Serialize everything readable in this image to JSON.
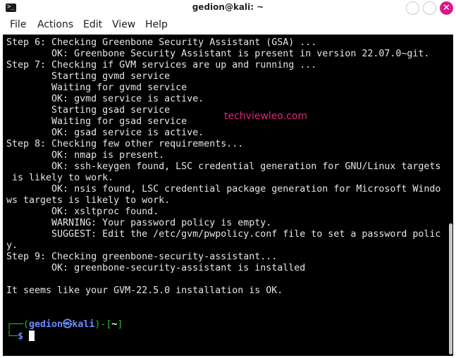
{
  "window": {
    "title": "gedion@kali: ~",
    "terminal_icon": "terminal-icon",
    "close_glyph": "✕",
    "accent_close": "#d6198b"
  },
  "menu": [
    "File",
    "Actions",
    "Edit",
    "View",
    "Help"
  ],
  "terminal": {
    "lines": [
      "Step 6: Checking Greenbone Security Assistant (GSA) ...",
      "        OK: Greenbone Security Assistant is present in version 22.07.0~git.",
      "Step 7: Checking if GVM services are up and running ...",
      "        Starting gvmd service",
      "        Waiting for gvmd service",
      "        OK: gvmd service is active.",
      "        Starting gsad service",
      "        Waiting for gsad service",
      "        OK: gsad service is active.",
      "Step 8: Checking few other requirements...",
      "        OK: nmap is present.",
      "        OK: ssh-keygen found, LSC credential generation for GNU/Linux targets",
      " is likely to work.",
      "        OK: nsis found, LSC credential package generation for Microsoft Windo",
      "ws targets is likely to work.",
      "        OK: xsltproc found.",
      "        WARNING: Your password policy is empty.",
      "        SUGGEST: Edit the /etc/gvm/pwpolicy.conf file to set a password polic",
      "y.",
      "Step 9: Checking greenbone-security-assistant...",
      "        OK: greenbone-security-assistant is installed",
      "",
      "It seems like your GVM-22.5.0 installation is OK.",
      "",
      ""
    ],
    "prompt": {
      "open": "┌──(",
      "user": "gedion㉿kali",
      "middle": ")-[",
      "dir": "~",
      "close": "]",
      "line2": "└─",
      "dollar": "$ "
    },
    "watermark": "techviewleo.com",
    "colors": {
      "prompt_frame": "#1ec61e",
      "prompt_user": "#6e8bff",
      "watermark": "#e0257a"
    }
  }
}
